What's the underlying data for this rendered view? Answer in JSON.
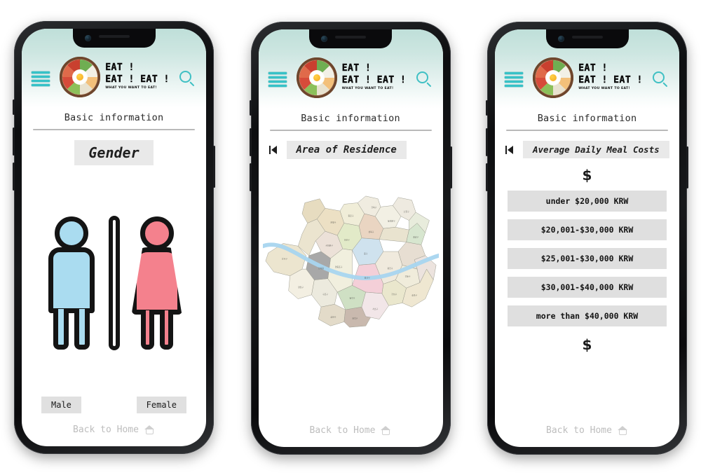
{
  "brand": {
    "line1": "EAT !",
    "line2": "EAT ! EAT !",
    "tagline": "WHAT YOU WANT TO EAT!",
    "logo_icon": "bibimbap-bowl-icon",
    "menu_icon": "hamburger-menu-icon",
    "search_icon": "search-icon",
    "accent_color": "#3fc0c4",
    "header_gradient_top": "#bfdfd9",
    "header_gradient_bottom": "#ffffff"
  },
  "common": {
    "page_title": "Basic information",
    "back_to_home": "Back to Home",
    "home_icon": "home-icon",
    "back_icon": "skip-to-start-icon"
  },
  "screens": [
    {
      "id": "gender",
      "section_title": "Gender",
      "has_back": false,
      "options": [
        {
          "label": "Male",
          "color": "#aadcf0"
        },
        {
          "label": "Female",
          "color": "#f4818d"
        }
      ]
    },
    {
      "id": "area-of-residence",
      "section_title": "Area of Residence",
      "has_back": true,
      "map": {
        "name": "seoul-district-map",
        "river_color": "#a8d5ef",
        "river_name": "Han River"
      }
    },
    {
      "id": "average-daily-meal-costs",
      "section_title": "Average Daily Meal Costs",
      "has_back": true,
      "currency_symbol": "$",
      "options": [
        "under $20,000 KRW",
        "$20,001-$30,000 KRW",
        "$25,001-$30,000 KRW",
        "$30,001-$40,000 KRW",
        "more than $40,000 KRW"
      ]
    }
  ]
}
